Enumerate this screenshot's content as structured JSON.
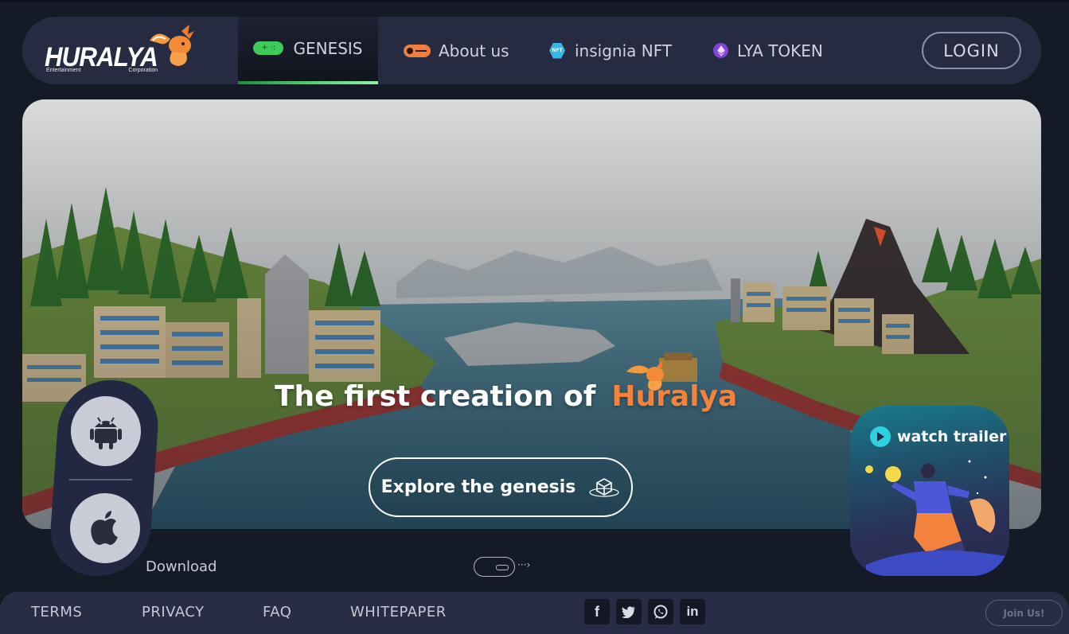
{
  "brand": {
    "name": "HURALYA",
    "subtitle_left": "Entertainment",
    "subtitle_right": "Corporation"
  },
  "nav": {
    "items": [
      {
        "label": "GENESIS",
        "icon": "gamepad-icon",
        "active": true
      },
      {
        "label": "About us",
        "icon": "toggle-icon",
        "active": false
      },
      {
        "label": "insignia NFT",
        "icon": "nft-icon",
        "nft_text": "NFT",
        "active": false
      },
      {
        "label": "LYA TOKEN",
        "icon": "ethereum-icon",
        "active": false
      }
    ],
    "login_label": "LOGIN"
  },
  "hero": {
    "title_prefix": "The first creation of",
    "title_accent": "Huralya",
    "explore_label": "Explore the genesis"
  },
  "download": {
    "label": "Download",
    "stores": [
      "android",
      "apple"
    ]
  },
  "trailer": {
    "label": "watch trailer"
  },
  "footer": {
    "links": [
      "TERMS",
      "PRIVACY",
      "FAQ",
      "WHITEPAPER"
    ],
    "social": [
      "facebook",
      "twitter",
      "whatsapp",
      "linkedin"
    ],
    "social_glyphs": [
      "f",
      "in"
    ],
    "join_label": "Join Us!"
  },
  "colors": {
    "background": "#141b26",
    "nav_bg": "#262b42",
    "accent_orange": "#f3823d",
    "accent_green": "#3ccc57",
    "accent_cyan": "#2fd0e0"
  }
}
